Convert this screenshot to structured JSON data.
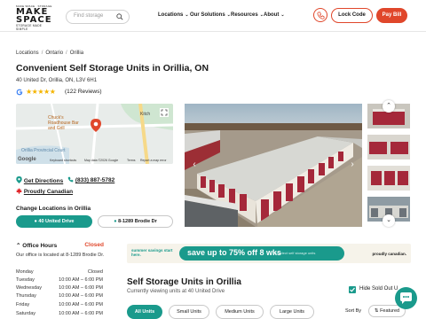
{
  "header": {
    "logo_top": "MAKE SPACE · STORAGE",
    "logo_main_1": "MAKE",
    "logo_main_2": "SPACE",
    "logo_bottom": "STORAGE MADE SIMPLE",
    "search_placeholder": "Find storage",
    "nav": [
      "Locations",
      "Our Solutions",
      "Resources",
      "About"
    ],
    "lock_code": "Lock Code",
    "pay_bill": "Pay Bill"
  },
  "breadcrumb": [
    "Locations",
    "Ontario",
    "Orillia"
  ],
  "page_title": "Convenient Self Storage Units in Orillia, ON",
  "address": "40 United Dr, Orillia, ON, L3V 6H1",
  "rating": {
    "stars": 5,
    "reviews_label": "(122 Reviews)"
  },
  "map": {
    "place1": "Chuck's Roadhouse Bar and Grill",
    "place2": "Kitch",
    "place3": "Orillia Provincial Court",
    "brand": "Google",
    "footer": [
      "Keyboard shortcuts",
      "Map data ©2026 Google",
      "Terms",
      "Report a map error"
    ]
  },
  "links": {
    "directions": "Get Directions",
    "phone": "(833) 887-5782",
    "canadian": "Proudly Canadian"
  },
  "change_location": {
    "heading": "Change Locations in Orillia",
    "options": [
      "40 United Drive",
      "8-1289 Brodie Dr"
    ]
  },
  "office_hours": {
    "heading": "Office Hours",
    "status": "Closed",
    "note": "Our office is located at 8-1289 Brodie Dr.",
    "rows": [
      {
        "day": "Monday",
        "time": "Closed"
      },
      {
        "day": "Tuesday",
        "time": "10:00 AM – 6:00 PM"
      },
      {
        "day": "Wednesday",
        "time": "10:00 AM – 6:00 PM"
      },
      {
        "day": "Thursday",
        "time": "10:00 AM – 6:00 PM"
      },
      {
        "day": "Friday",
        "time": "10:00 AM – 6:00 PM"
      },
      {
        "day": "Saturday",
        "time": "10:00 AM – 6:00 PM"
      }
    ]
  },
  "promo": {
    "summer": "summer savings start here.",
    "deal": "save up to 75% off 8 wks",
    "deal_sub": "on select self storage units",
    "proudly": "proudly canadian."
  },
  "units": {
    "title": "Self Storage Units in Orillia",
    "subtitle": "Currently viewing units at 40 United Drive",
    "hide_sold": "Hide Sold Out U",
    "tabs": [
      "All Units",
      "Small Units",
      "Medium Units",
      "Large Units"
    ],
    "sort_label": "Sort By",
    "sort_value": "Featured"
  },
  "colors": {
    "accent": "#e0472b",
    "teal": "#1a9a8c",
    "star": "#f4b400"
  }
}
